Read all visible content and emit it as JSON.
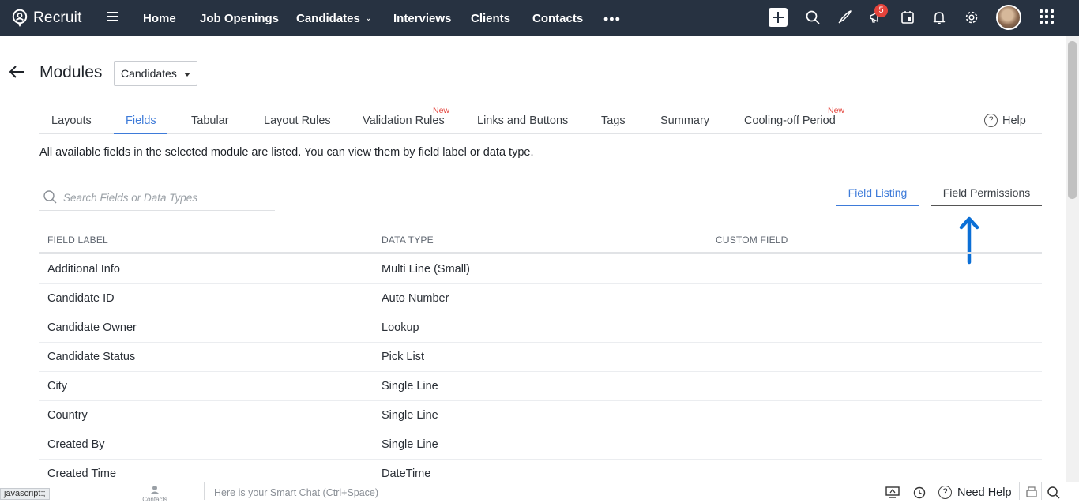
{
  "app": {
    "name": "Recruit"
  },
  "nav": {
    "items": [
      {
        "label": "Home"
      },
      {
        "label": "Job Openings"
      },
      {
        "label": "Candidates"
      },
      {
        "label": "Interviews"
      },
      {
        "label": "Clients"
      },
      {
        "label": "Contacts"
      }
    ],
    "more": "•••",
    "notification_count": "5"
  },
  "header": {
    "title": "Modules",
    "module_selected": "Candidates"
  },
  "tabs": [
    {
      "label": "Layouts"
    },
    {
      "label": "Fields"
    },
    {
      "label": "Tabular"
    },
    {
      "label": "Layout Rules"
    },
    {
      "label": "Validation Rules",
      "tag": "New"
    },
    {
      "label": "Links and Buttons"
    },
    {
      "label": "Tags"
    },
    {
      "label": "Summary"
    },
    {
      "label": "Cooling-off Period",
      "tag": "New"
    }
  ],
  "help_label": "Help",
  "description": "All available fields in the selected module are listed. You can view them by field label or data type.",
  "search": {
    "placeholder": "Search Fields or Data Types"
  },
  "view_toggle": {
    "listing": "Field Listing",
    "permissions": "Field Permissions"
  },
  "table": {
    "columns": [
      "FIELD LABEL",
      "DATA TYPE",
      "CUSTOM FIELD"
    ],
    "rows": [
      {
        "label": "Additional Info",
        "type": "Multi Line (Small)",
        "custom": ""
      },
      {
        "label": "Candidate ID",
        "type": "Auto Number",
        "custom": ""
      },
      {
        "label": "Candidate Owner",
        "type": "Lookup",
        "custom": ""
      },
      {
        "label": "Candidate Status",
        "type": "Pick List",
        "custom": ""
      },
      {
        "label": "City",
        "type": "Single Line",
        "custom": ""
      },
      {
        "label": "Country",
        "type": "Single Line",
        "custom": ""
      },
      {
        "label": "Created By",
        "type": "Single Line",
        "custom": ""
      },
      {
        "label": "Created Time",
        "type": "DateTime",
        "custom": ""
      }
    ]
  },
  "bottom": {
    "status_text": "javascript:;",
    "contacts_label": "Contacts",
    "smart_chat_placeholder": "Here is your Smart Chat (Ctrl+Space)",
    "need_help": "Need Help"
  },
  "colors": {
    "topbar": "#273241",
    "accent": "#3e7bd9",
    "new_tag": "#e4433b",
    "annotation_arrow": "#0b6fd6"
  }
}
